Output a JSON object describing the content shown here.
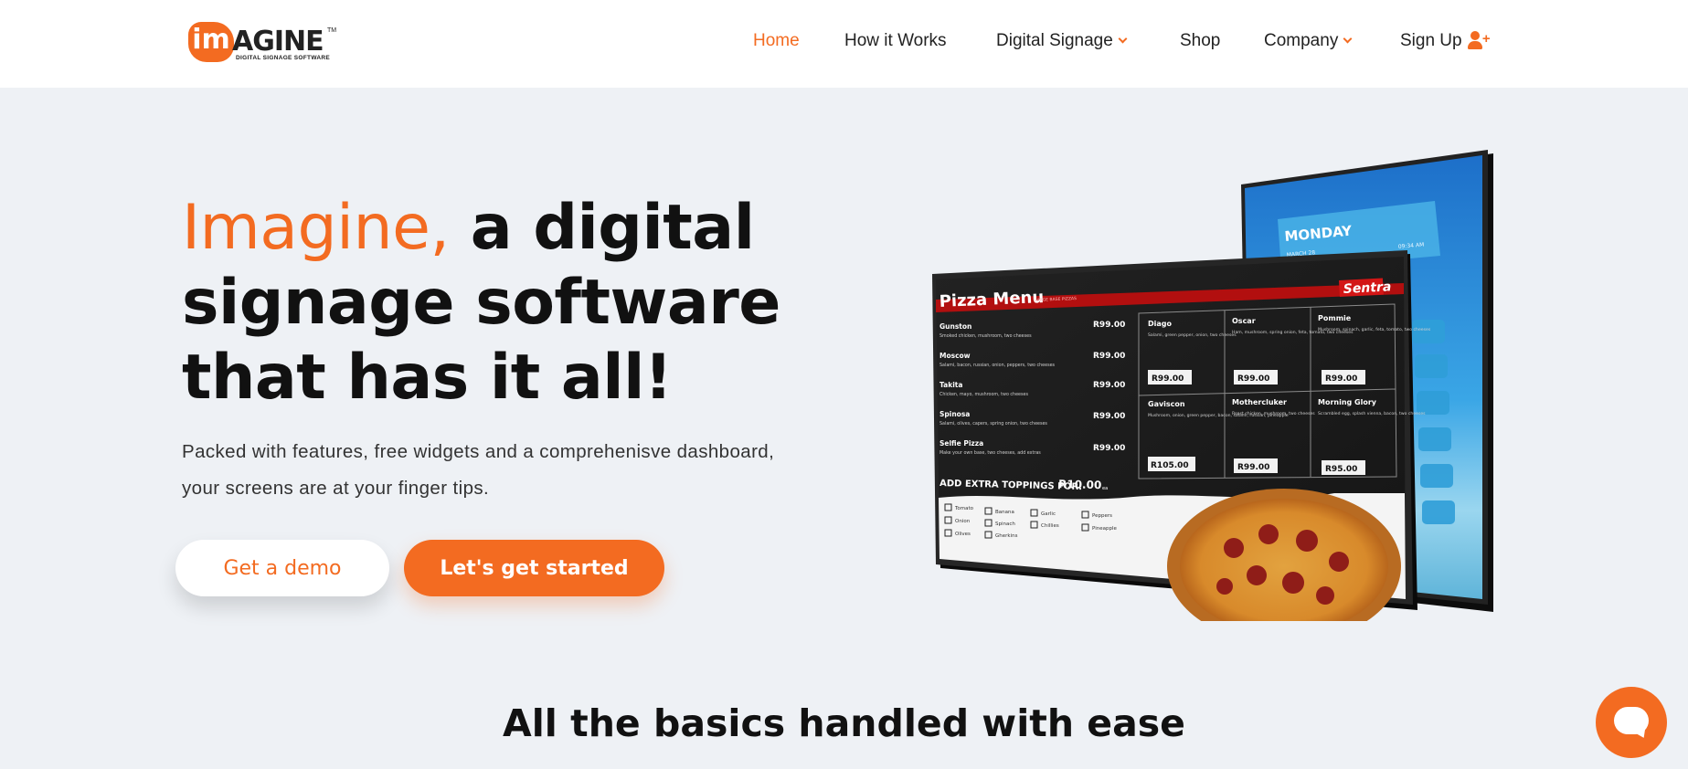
{
  "nav": {
    "logo": {
      "mark": "im",
      "word": "AGINE",
      "tm": "TM",
      "tagline": "DIGITAL SIGNAGE SOFTWARE"
    },
    "items": [
      {
        "label": "Home",
        "active": true
      },
      {
        "label": "How it Works"
      },
      {
        "label": "Digital Signage",
        "dropdown": true
      },
      {
        "label": "Shop"
      },
      {
        "label": "Company",
        "dropdown": true
      },
      {
        "label": "Sign Up",
        "icon": "user-plus-icon"
      }
    ]
  },
  "hero": {
    "title_accent": "Imagine,",
    "title_rest_1": "a digital",
    "title_rest_2": "signage software",
    "title_rest_3": "that has it all!",
    "description_line1": "Packed with features, free widgets and a comprehenisve dashboard,",
    "description_line2": "your screens are at your finger tips.",
    "demo_button": "Get a demo",
    "start_button": "Let's get started"
  },
  "screens": {
    "back_screen": {
      "day": "MONDAY",
      "date": "MARCH 28",
      "time": "09:34 AM"
    },
    "menu": {
      "title": "Pizza Menu",
      "subtitle": "LARGE BASE PIZZAS",
      "brand": "Sentra",
      "left_items": [
        {
          "name": "Gunston",
          "desc": "Smoked chicken, mushroom, two cheeses",
          "price": "R99.00"
        },
        {
          "name": "Moscow",
          "desc": "Salami, bacon, russian, onion, peppers, two cheeses",
          "price": "R99.00"
        },
        {
          "name": "Takita",
          "desc": "Chicken, mayo, mushroom, two cheeses",
          "price": "R99.00"
        },
        {
          "name": "Spinosa",
          "desc": "Salami, olives, capers, spring onion, two cheeses",
          "price": "R99.00"
        },
        {
          "name": "Selfie Pizza",
          "desc": "Make your own base, two cheeses, add extras",
          "price": "R99.00"
        }
      ],
      "grid_items": [
        {
          "name": "Diago",
          "desc": "Salami, green pepper, onion, two cheeses",
          "price": "R99.00"
        },
        {
          "name": "Oscar",
          "desc": "Ham, mushroom, spring onion, feta, tomato, two cheeses",
          "price": "R99.00"
        },
        {
          "name": "Pommie",
          "desc": "Mushroom, spinach, garlic, feta, tomato, two cheeses",
          "price": "R99.00"
        },
        {
          "name": "Gaviscon",
          "desc": "Mushroom, onion, green pepper, bacon, salami, russian, pineapple",
          "price": "R105.00"
        },
        {
          "name": "Mothercluker",
          "desc": "Roast chicken, mushroom, two cheeses",
          "price": "R99.00"
        },
        {
          "name": "Morning Glory",
          "desc": "Scrambled egg, splash vienna, bacon, two cheeses",
          "price": "R95.00"
        }
      ],
      "extras_label": "ADD EXTRA TOPPINGS FOR:",
      "extras_price": "R10.00",
      "extras_suffix": "ea",
      "toppings": [
        "Tomato",
        "Onion",
        "Olives",
        "Banana",
        "Spinach",
        "Gherkins",
        "Garlic",
        "Chillies",
        "Peppers",
        "Pineapple"
      ]
    }
  },
  "section": {
    "heading": "All the basics handled with ease"
  },
  "colors": {
    "accent": "#f36b21",
    "background": "#eef1f5"
  }
}
